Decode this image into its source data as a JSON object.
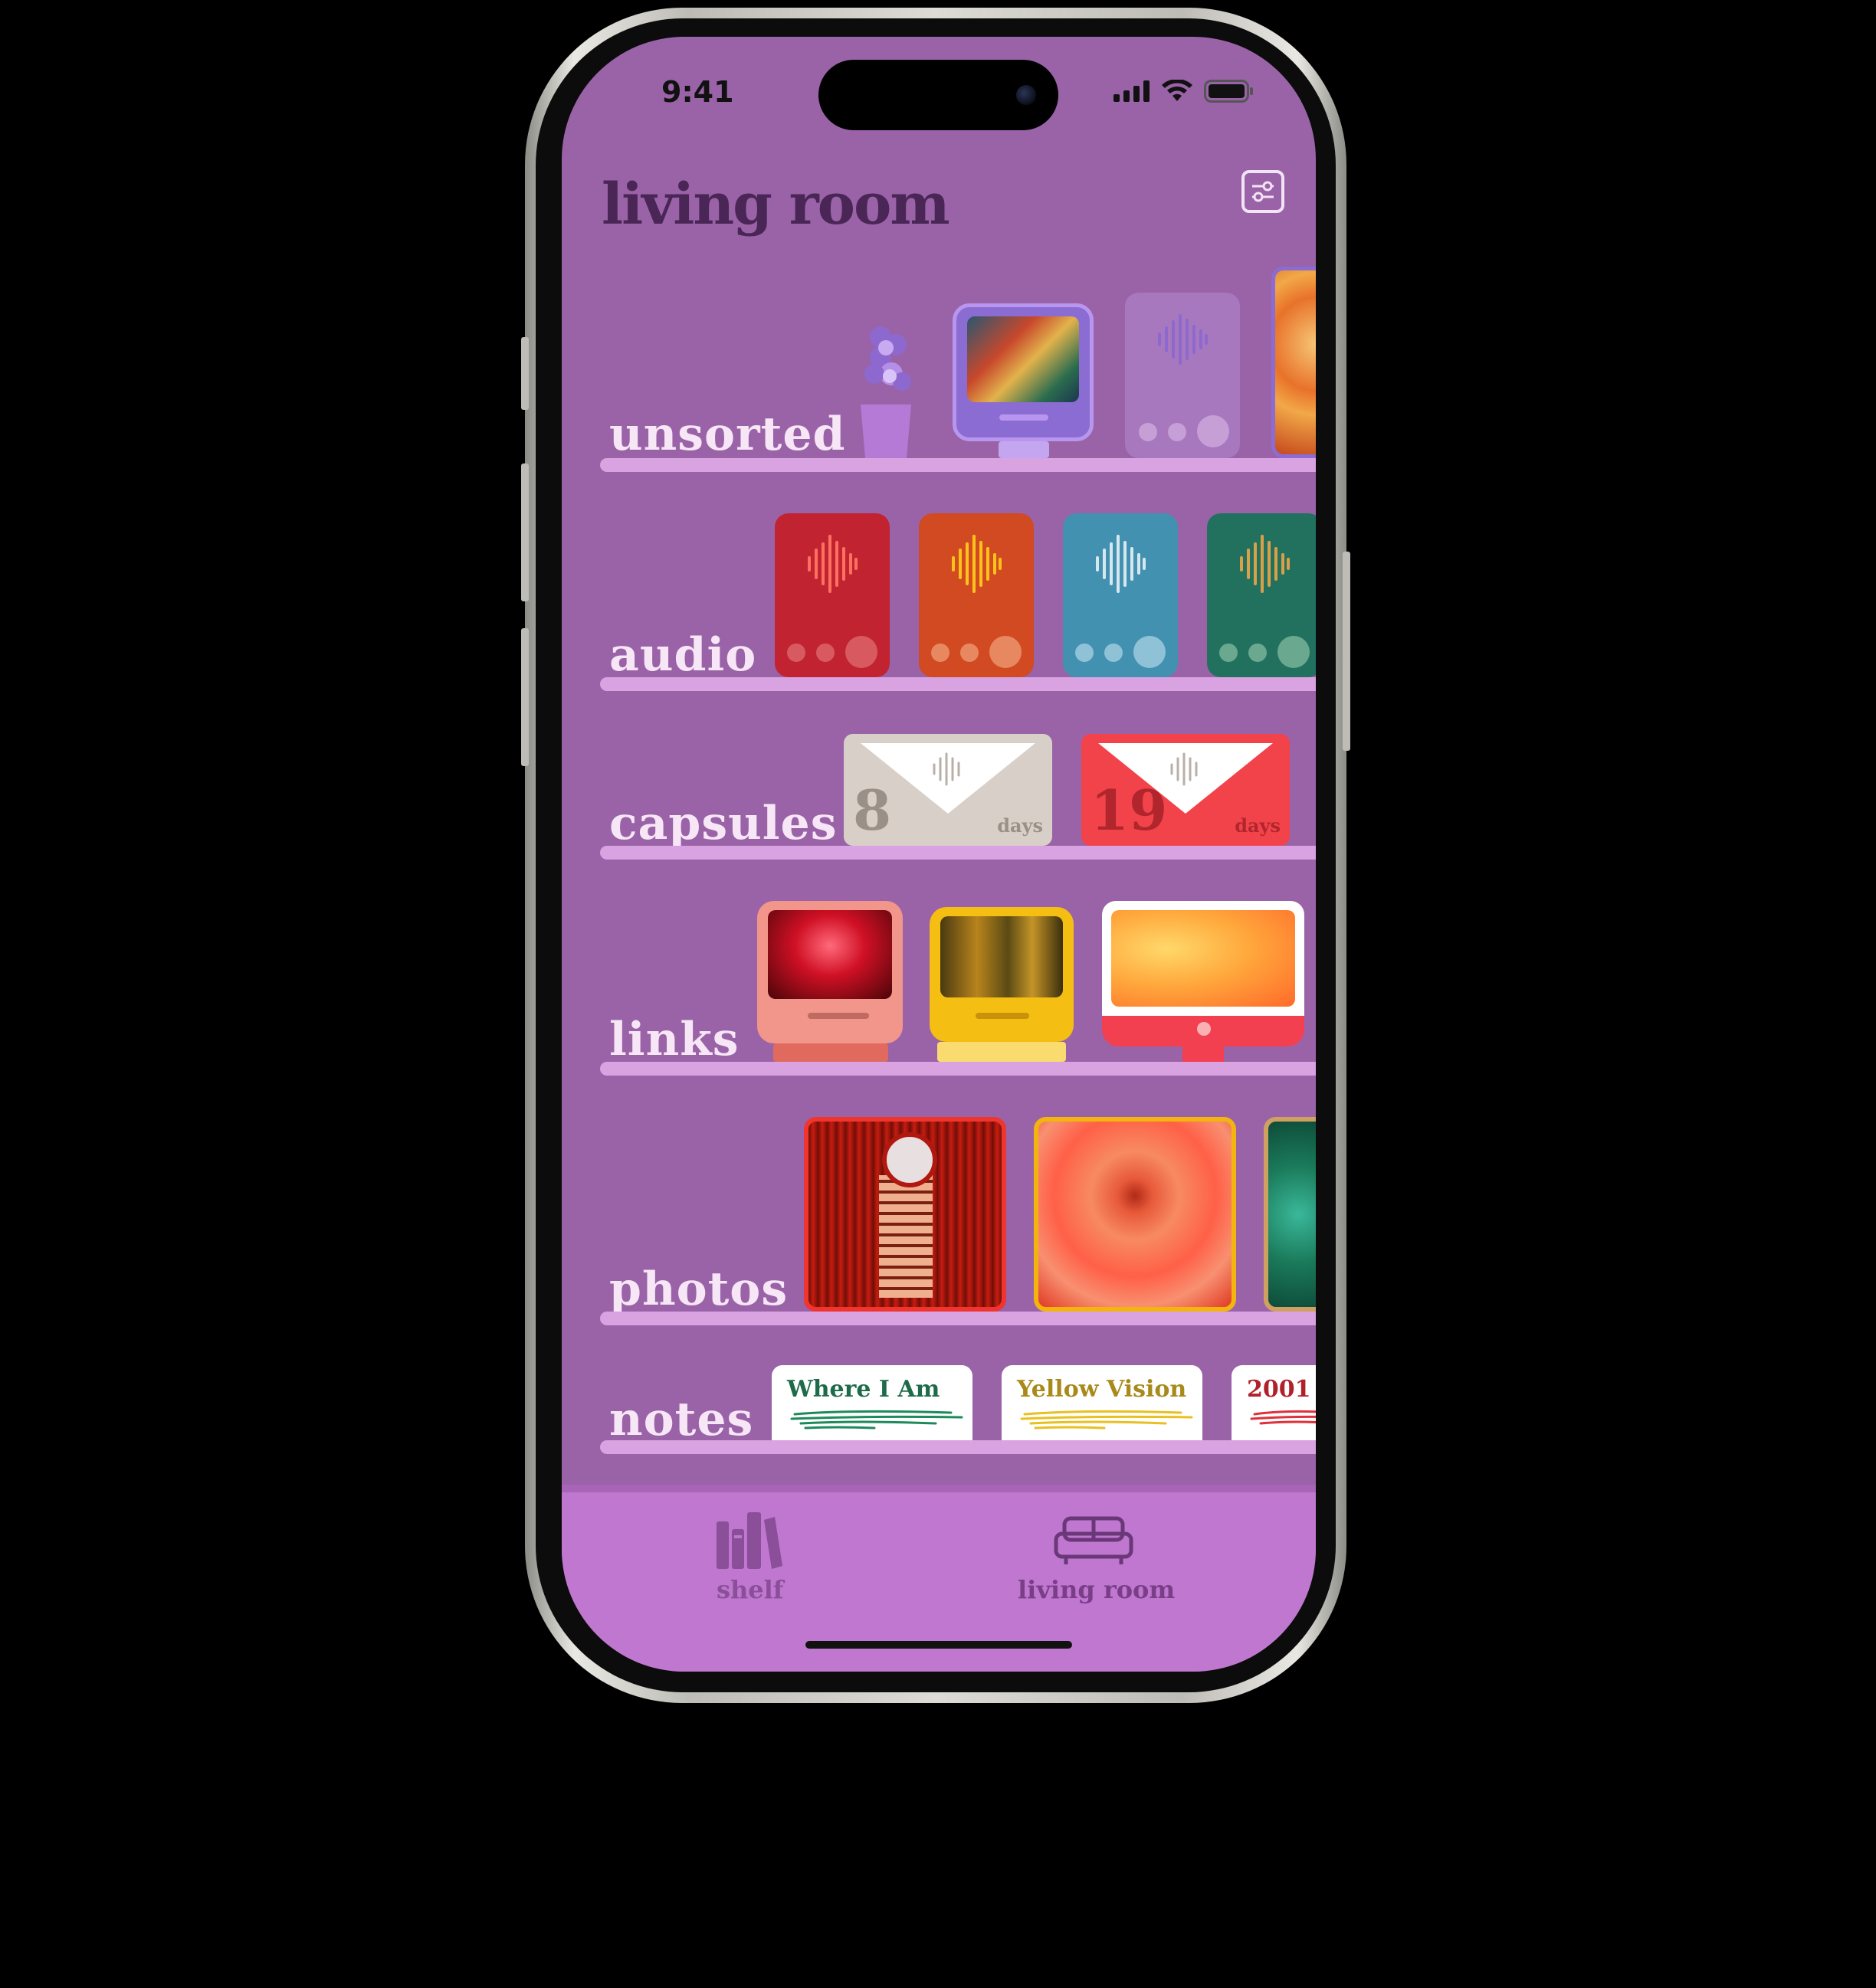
{
  "status_bar": {
    "time": "9:41"
  },
  "header": {
    "title": "living room",
    "settings_icon": "sliders-icon"
  },
  "shelves": [
    {
      "label": "unsorted"
    },
    {
      "label": "audio"
    },
    {
      "label": "capsules"
    },
    {
      "label": "links"
    },
    {
      "label": "photos"
    },
    {
      "label": "notes"
    }
  ],
  "capsules": [
    {
      "number": "8",
      "unit": "days",
      "color": "#d8d0c8"
    },
    {
      "number": "19",
      "unit": "days",
      "color": "#f2434b"
    }
  ],
  "audio_colors": [
    "#c12330",
    "#d14a22",
    "#4291b0",
    "#22715f"
  ],
  "notes": [
    {
      "title": "Where I Am",
      "color": "#1e6b4a"
    },
    {
      "title": "Yellow Vision",
      "color": "#a8891a"
    },
    {
      "title": "2001",
      "color": "#b0212b"
    }
  ],
  "tabs": [
    {
      "label": "shelf",
      "icon": "books-icon"
    },
    {
      "label": "living room",
      "icon": "sofa-icon",
      "active": true
    }
  ],
  "colors": {
    "screen_bg": "#9a63a8",
    "tabbar_bg": "#bf77cf",
    "shelf_board": "#d8a3e0",
    "title": "#4a2656"
  }
}
